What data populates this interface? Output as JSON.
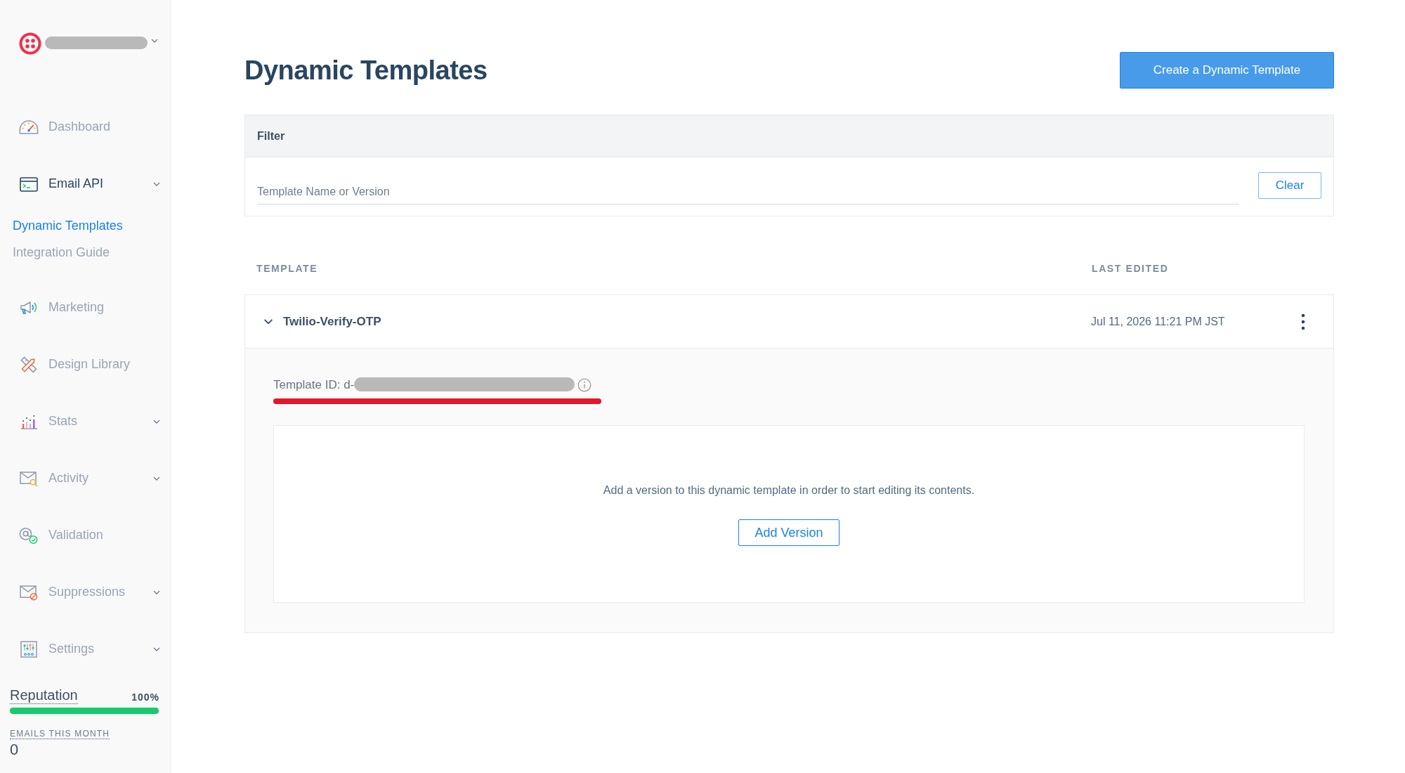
{
  "sidebar": {
    "nav_items": [
      {
        "label": "Dashboard",
        "selected": false,
        "expandable": false,
        "expanded": false
      },
      {
        "label": "Email API",
        "selected": false,
        "expandable": true,
        "expanded": true,
        "children": [
          {
            "label": "Dynamic Templates",
            "selected": true
          },
          {
            "label": "Integration Guide",
            "selected": false
          }
        ]
      },
      {
        "label": "Marketing",
        "selected": false,
        "expandable": false,
        "expanded": false
      },
      {
        "label": "Design Library",
        "selected": false,
        "expandable": false,
        "expanded": false
      },
      {
        "label": "Stats",
        "selected": false,
        "expandable": true,
        "expanded": false
      },
      {
        "label": "Activity",
        "selected": false,
        "expandable": true,
        "expanded": false
      },
      {
        "label": "Validation",
        "selected": false,
        "expandable": false,
        "expanded": false
      },
      {
        "label": "Suppressions",
        "selected": false,
        "expandable": true,
        "expanded": false
      },
      {
        "label": "Settings",
        "selected": false,
        "expandable": true,
        "expanded": false
      }
    ],
    "reputation": {
      "label": "Reputation",
      "value": "100%",
      "level": 1
    },
    "emails_this_month": {
      "label": "EMAILS THIS MONTH",
      "value": "0"
    }
  },
  "header": {
    "title": "Dynamic Templates",
    "create_button": "Create a Dynamic Template"
  },
  "filter": {
    "title": "Filter",
    "search": {
      "placeholder": "Template Name or Version"
    },
    "clear_button": "Clear"
  },
  "table": {
    "columns": [
      "TEMPLATE",
      "LAST EDITED"
    ],
    "rows": [
      {
        "name": "Twilio-Verify-OTP",
        "last_edited": "Jul 11, 2026 11:21 PM JST",
        "expanded": true,
        "template_id_label": "Template ID: d-",
        "empty_message": "Add a version to this dynamic template in order to start editing its contents.",
        "add_version_button": "Add Version"
      }
    ]
  }
}
